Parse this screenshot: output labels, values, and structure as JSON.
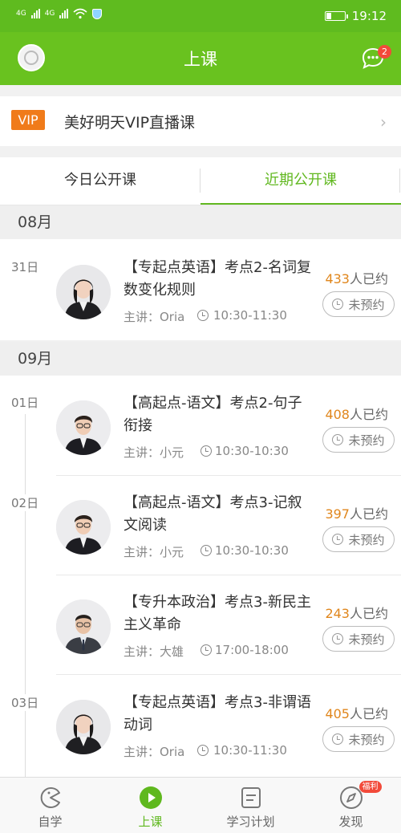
{
  "status_bar": {
    "time": "19:12",
    "net1": "4G",
    "net2": "4G"
  },
  "header": {
    "title": "上课",
    "message_badge": "2"
  },
  "vip": {
    "tag": "VIP",
    "label": "美好明天VIP直播课",
    "chevron": "›"
  },
  "tabs": [
    {
      "label": "今日公开课",
      "active": false
    },
    {
      "label": "近期公开课",
      "active": true
    }
  ],
  "months": [
    "08月",
    "09月"
  ],
  "dates": [
    "31日",
    "01日",
    "02日",
    "03日"
  ],
  "courses": [
    {
      "title": "【专起点英语】考点2-名词复数变化规则",
      "teacher": "主讲：Oria",
      "time": "10:30-11:30",
      "count": "433",
      "count_suffix": "人已约",
      "button": "未预约",
      "avatar": "female-teacher"
    },
    {
      "title": "【高起点-语文】考点2-句子衔接",
      "teacher": "主讲：小元",
      "time": "10:30-10:30",
      "count": "408",
      "count_suffix": "人已约",
      "button": "未预约",
      "avatar": "male-teacher-glasses"
    },
    {
      "title": "【高起点-语文】考点3-记叙文阅读",
      "teacher": "主讲：小元",
      "time": "10:30-10:30",
      "count": "397",
      "count_suffix": "人已约",
      "button": "未预约",
      "avatar": "male-teacher-glasses"
    },
    {
      "title": "【专升本政治】考点3-新民主主义革命",
      "teacher": "主讲：大雄",
      "time": "17:00-18:00",
      "count": "243",
      "count_suffix": "人已约",
      "button": "未预约",
      "avatar": "male-teacher-suit"
    },
    {
      "title": "【专起点英语】考点3-非谓语动词",
      "teacher": "主讲：Oria",
      "time": "10:30-11:30",
      "count": "405",
      "count_suffix": "人已约",
      "button": "未预约",
      "avatar": "female-teacher"
    }
  ],
  "bottom_nav": [
    {
      "label": "自学",
      "icon": "pacman-icon",
      "active": false
    },
    {
      "label": "上课",
      "icon": "play-icon",
      "active": true
    },
    {
      "label": "学习计划",
      "icon": "plan-icon",
      "active": false
    },
    {
      "label": "发现",
      "icon": "compass-icon",
      "active": false,
      "badge": "福利"
    }
  ],
  "colors": {
    "primary_green": "#69c21f",
    "accent_orange": "#e0861c",
    "vip_orange": "#f07b1a",
    "badge_red": "#f24a3a"
  }
}
